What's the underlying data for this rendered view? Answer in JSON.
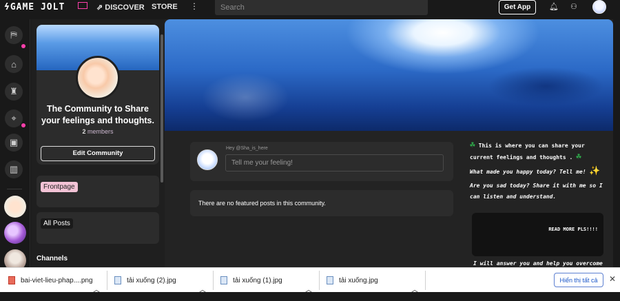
{
  "topbar": {
    "logo": "GAME JOLT",
    "discover": "DISCOVER",
    "store": "STORE",
    "more": "⋮",
    "search_placeholder": "Search",
    "get_app": "Get App"
  },
  "community": {
    "title": "The Community to Share your feelings and thoughts.",
    "member_count": "2",
    "member_label": "members",
    "edit_button": "Edit Community",
    "channels": {
      "frontpage": "Frontpage",
      "all_posts": "All Posts",
      "heading": "Channels"
    }
  },
  "feed": {
    "greeting": "Hey @Sha_is_here",
    "post_placeholder": "Tell me your feeling!",
    "no_featured": "There are no featured posts in this community."
  },
  "description": {
    "line1": "This is where you can share your current   feelings and thoughts .",
    "line2": "What made you happy today? Tell me!",
    "line3": "Are you sad today? Share it with me so I can listen and understand.",
    "read_more": "READ MORE PLS!!!!",
    "line4": "I will answer you and help you overcome"
  },
  "downloads": {
    "items": [
      {
        "name": "bai-viet-lieu-phap....png"
      },
      {
        "name": "tải xuống (2).jpg"
      },
      {
        "name": "tải xuống (1).jpg"
      },
      {
        "name": "tải xuống.jpg"
      }
    ],
    "show_all": "Hiển thị tất cả"
  },
  "colors": {
    "accent": "#ff3fac",
    "background": "#191919",
    "card": "#2c2c2c"
  },
  "icons": [
    "flash-icon",
    "compass-icon",
    "more-icon",
    "bell-icon",
    "friends-icon",
    "clover-icon",
    "sparkle-icon",
    "chevron-up-icon",
    "close-icon"
  ]
}
